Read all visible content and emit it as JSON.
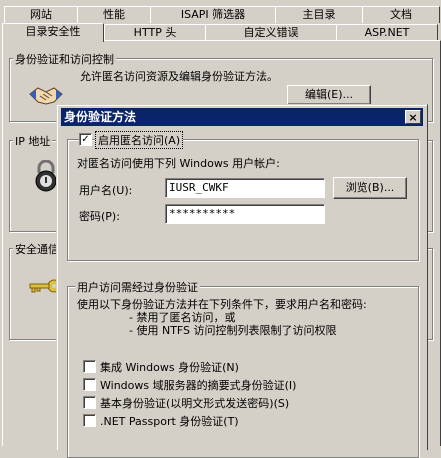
{
  "tabs_row1": [
    "网站",
    "性能",
    "ISAPI 筛选器",
    "主目录",
    "文档"
  ],
  "tabs_row2": [
    "目录安全性",
    "HTTP 头",
    "自定义错误",
    "ASP.NET"
  ],
  "auth_group": {
    "title": "身份验证和访问控制",
    "desc": "允许匿名访问资源及编辑身份验证方法。",
    "edit_label": "编辑(E)..."
  },
  "ip_group": {
    "title": "IP 地址"
  },
  "secure_group": {
    "title": "安全通信"
  },
  "dialog": {
    "title": "身份验证方法",
    "close": "×",
    "anon_check_label": "启用匿名访问(A)",
    "anon_checked": true,
    "anon_desc": "对匿名访问使用下列 Windows 用户帐户:",
    "username_label": "用户名(U):",
    "username_value": "IUSR_CWKF",
    "browse_label": "浏览(B)...",
    "password_label": "密码(P):",
    "password_value": "**********",
    "auth_access_group": {
      "title": "用户访问需经过身份验证",
      "desc": "使用以下身份验证方法并在下列条件下，要求用户名和密码:",
      "bullets": [
        "- 禁用了匿名访问，或",
        "- 使用 NTFS 访问控制列表限制了访问权限"
      ],
      "options": [
        "集成 Windows 身份验证(N)",
        "Windows 域服务器的摘要式身份验证(I)",
        "基本身份验证(以明文形式发送密码)(S)",
        ".NET Passport 身份验证(T)"
      ]
    }
  }
}
